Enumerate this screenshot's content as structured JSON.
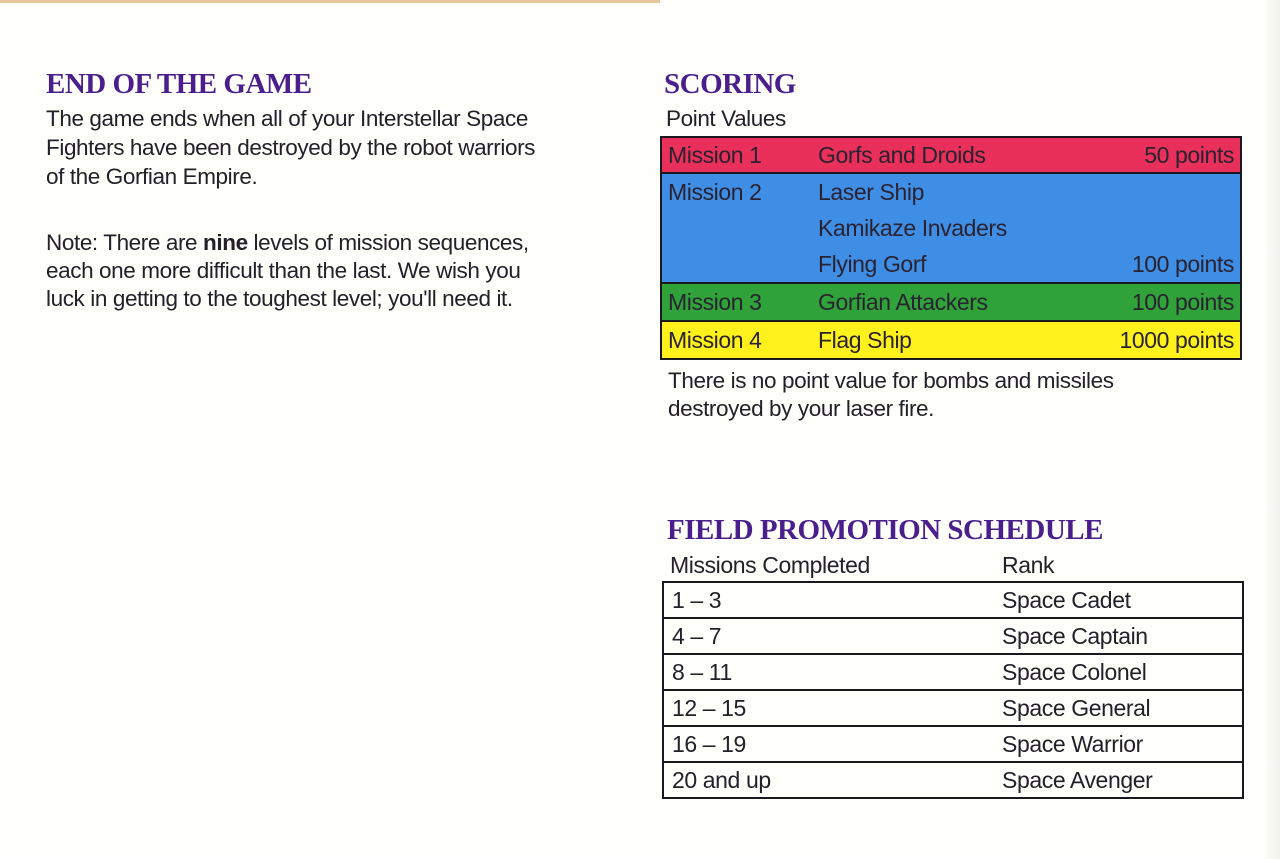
{
  "end_of_game": {
    "heading": "END OF THE GAME",
    "paragraph_lines": [
      "The game ends when all of your Interstellar Space",
      "Fighters have been destroyed by the robot warriors",
      "of the Gorfian Empire."
    ],
    "note_prefix": "Note: There are ",
    "note_bold": "nine",
    "note_suffix": " levels of mission sequences,",
    "note_lines": [
      "each one more difficult than the last. We wish you",
      "luck in getting to the toughest level; you'll need it."
    ]
  },
  "scoring": {
    "heading": "SCORING",
    "subheading": "Point Values",
    "rows": [
      {
        "mission": "Mission 1",
        "color": "#e8305a",
        "lines": [
          {
            "target": "Gorfs and Droids",
            "points": "50 points"
          }
        ]
      },
      {
        "mission": "Mission 2",
        "color": "#3f8ee6",
        "lines": [
          {
            "target": "Laser Ship",
            "points": ""
          },
          {
            "target": "Kamikaze Invaders",
            "points": ""
          },
          {
            "target": "Flying Gorf",
            "points": "100 points"
          }
        ]
      },
      {
        "mission": "Mission 3",
        "color": "#2fa33a",
        "lines": [
          {
            "target": "Gorfian Attackers",
            "points": "100 points"
          }
        ]
      },
      {
        "mission": "Mission 4",
        "color": "#fff21c",
        "lines": [
          {
            "target": "Flag Ship",
            "points": "1000 points"
          }
        ]
      }
    ],
    "footnote_lines": [
      "There is no point value for bombs and missiles",
      "destroyed by your laser fire."
    ]
  },
  "promotion": {
    "heading": "FIELD PROMOTION SCHEDULE",
    "col_missions": "Missions Completed",
    "col_rank": "Rank",
    "rows": [
      {
        "missions": "1 – 3",
        "rank": "Space Cadet"
      },
      {
        "missions": "4 – 7",
        "rank": "Space Captain"
      },
      {
        "missions": "8 – 11",
        "rank": "Space Colonel"
      },
      {
        "missions": "12 – 15",
        "rank": "Space General"
      },
      {
        "missions": "16 – 19",
        "rank": "Space Warrior"
      },
      {
        "missions": "20 and up",
        "rank": "Space Avenger"
      }
    ]
  }
}
